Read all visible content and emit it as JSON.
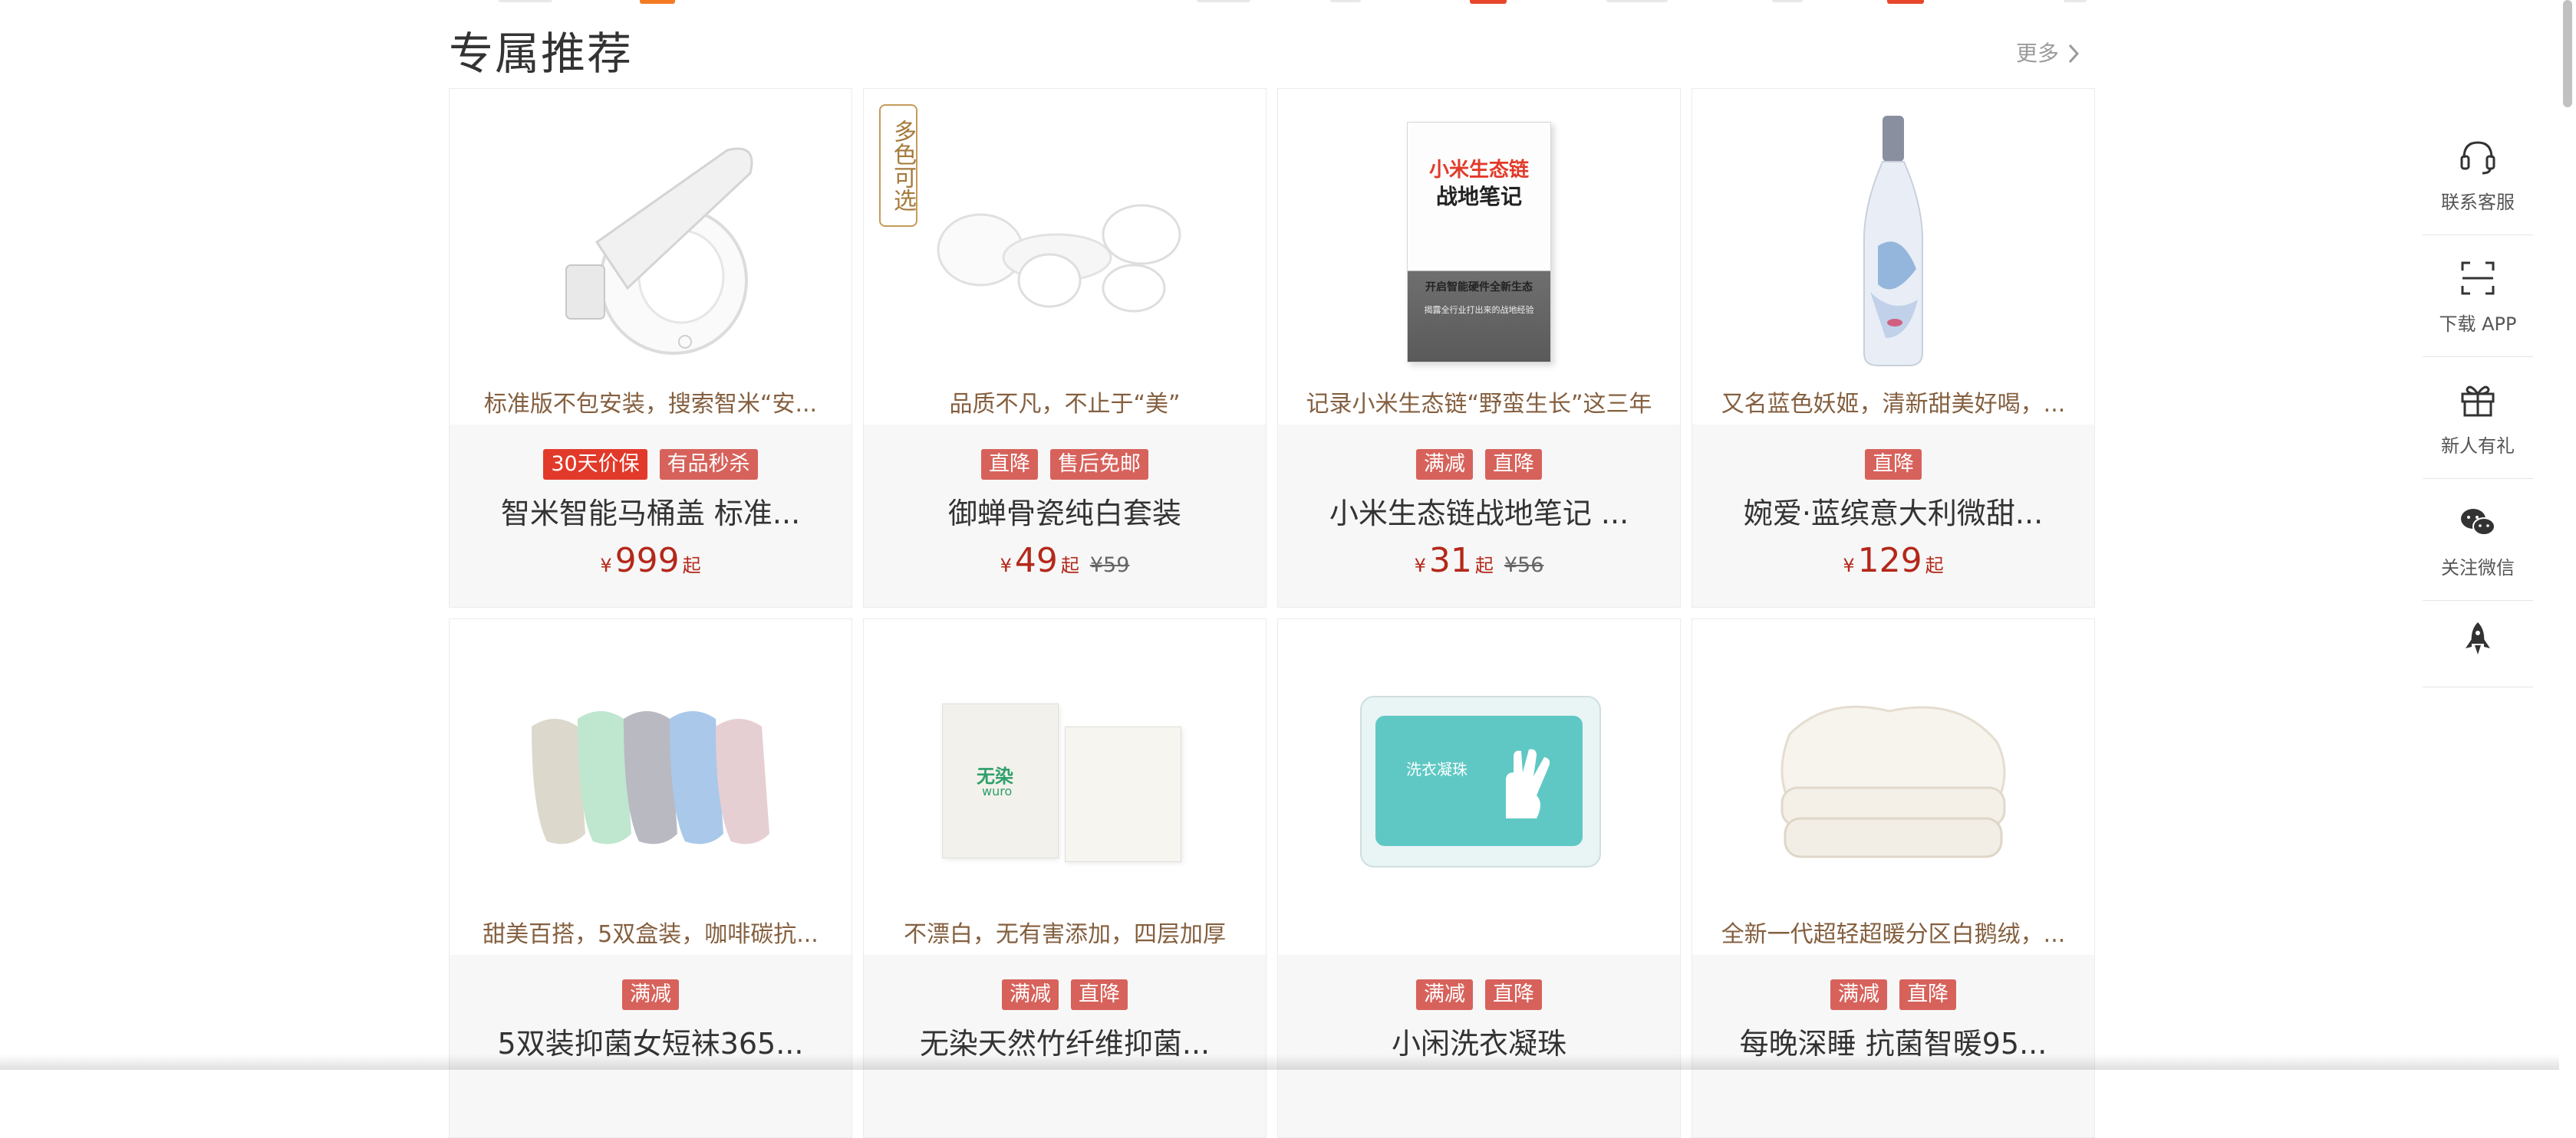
{
  "section": {
    "title": "专属推荐",
    "more_label": "更多"
  },
  "products": [
    {
      "desc": "标准版不包安装，搜索智米“安...",
      "tags": [
        "30天价保",
        "有品秒杀"
      ],
      "tag_styles": [
        "hot",
        "normal"
      ],
      "name": "智米智能马桶盖 标准...",
      "price_symbol": "¥",
      "price": "999",
      "price_suffix": "起",
      "old_price": "",
      "image_icon": "toilet-seat-image"
    },
    {
      "desc": "品质不凡，不止于“美”",
      "tags": [
        "直降",
        "售后免邮"
      ],
      "tag_styles": [
        "normal",
        "normal"
      ],
      "name": "御蝉骨瓷纯白套装",
      "price_symbol": "¥",
      "price": "49",
      "price_suffix": "起",
      "old_price": "¥59",
      "badge": "多色可选",
      "image_icon": "porcelain-set-image"
    },
    {
      "desc": "记录小米生态链“野蛮生长”这三年",
      "tags": [
        "满减",
        "直降"
      ],
      "tag_styles": [
        "normal",
        "normal"
      ],
      "name": "小米生态链战地笔记 ...",
      "price_symbol": "¥",
      "price": "31",
      "price_suffix": "起",
      "old_price": "¥56",
      "image_icon": "book-image",
      "book": {
        "title_line1": "小米生态链",
        "title_line2": "战地笔记",
        "sub1": "开启智能硬件全新生态",
        "sub2": "揭露全行业打出来的战地经验"
      }
    },
    {
      "desc": "又名蓝色妖姬，清新甜美好喝，...",
      "tags": [
        "直降"
      ],
      "tag_styles": [
        "normal"
      ],
      "name": "婉爱·蓝缤意大利微甜...",
      "price_symbol": "¥",
      "price": "129",
      "price_suffix": "起",
      "old_price": "",
      "image_icon": "wine-bottle-image"
    },
    {
      "desc": "甜美百搭，5双盒装，咖啡碳抗...",
      "tags": [
        "满减"
      ],
      "tag_styles": [
        "normal"
      ],
      "name": "5双装抑菌女短袜365...",
      "image_icon": "socks-image"
    },
    {
      "desc": "不漂白，无有害添加，四层加厚",
      "tags": [
        "满减",
        "直降"
      ],
      "tag_styles": [
        "normal",
        "normal"
      ],
      "name": "无染天然竹纤维抑菌...",
      "image_icon": "tissue-pack-image",
      "pack": {
        "brand_cn": "无染",
        "brand_en": "wuro"
      }
    },
    {
      "desc": "",
      "tags": [
        "满减",
        "直降"
      ],
      "tag_styles": [
        "normal",
        "normal"
      ],
      "name": "小闲洗衣凝珠",
      "image_icon": "laundry-pods-image",
      "pack": {
        "label": "洗衣凝珠"
      }
    },
    {
      "desc": "全新一代超轻超暖分区白鹅绒，...",
      "tags": [
        "满减",
        "直降"
      ],
      "tag_styles": [
        "normal",
        "normal"
      ],
      "name": "每晚深睡 抗菌智暖95...",
      "image_icon": "duvet-image"
    }
  ],
  "toolbar": [
    {
      "label": "联系客服",
      "icon": "headset-icon"
    },
    {
      "label": "下载 APP",
      "icon": "scan-icon"
    },
    {
      "label": "新人有礼",
      "icon": "gift-icon"
    },
    {
      "label": "关注微信",
      "icon": "wechat-icon"
    },
    {
      "label": "",
      "icon": "rocket-icon"
    }
  ],
  "colors": {
    "desc_text": "#845f3f",
    "tag_bg": "#d7625b",
    "tag_hot_bg": "#e23a2a",
    "price": "#b4281a",
    "info_bg": "#f7f7f7"
  }
}
